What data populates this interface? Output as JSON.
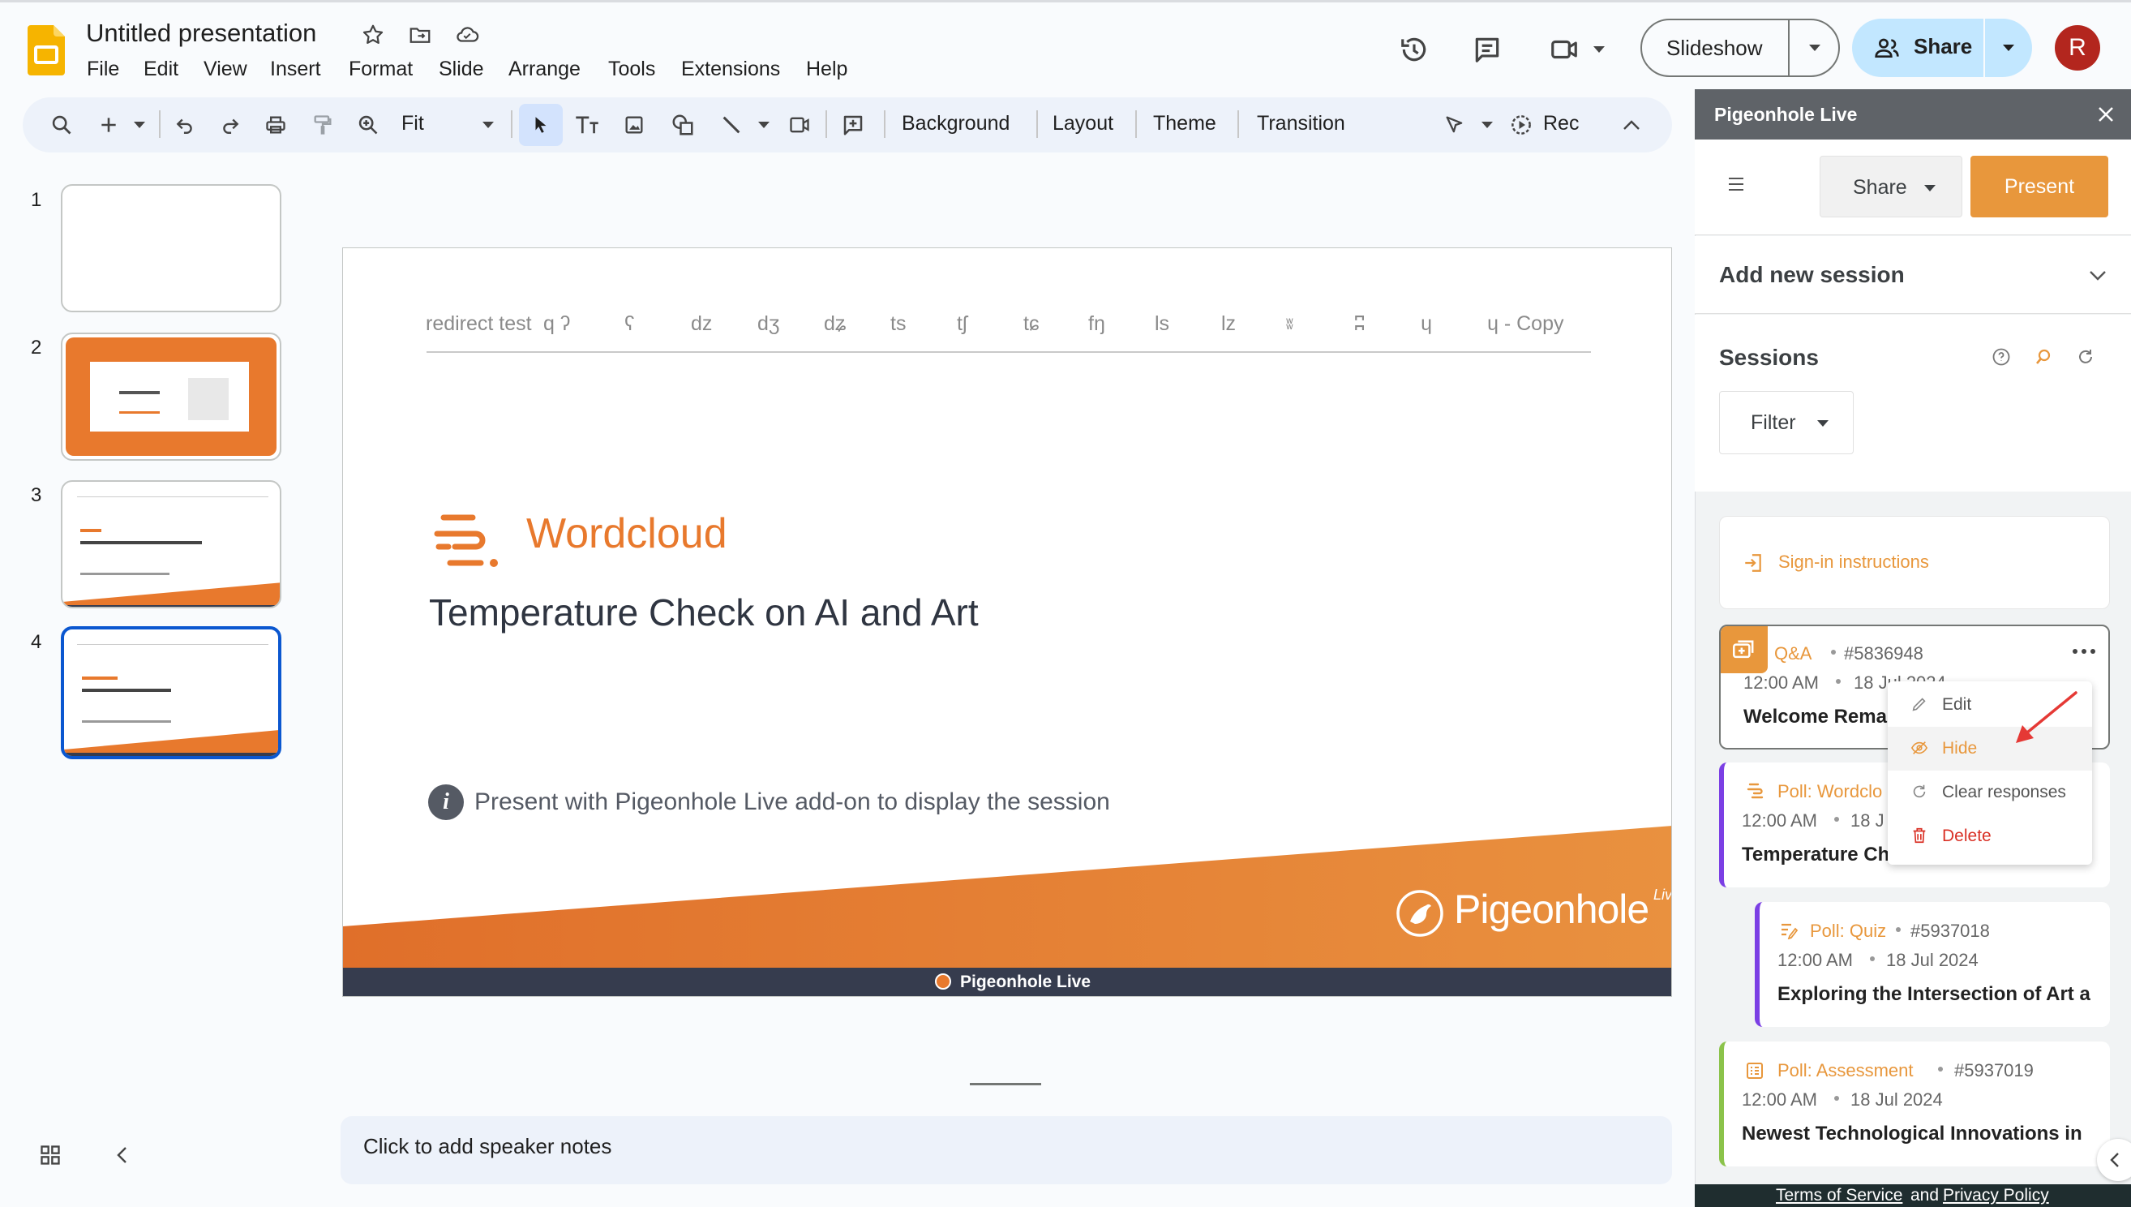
{
  "app": {
    "doc_title": "Untitled presentation",
    "menus": [
      "File",
      "Edit",
      "View",
      "Insert",
      "Format",
      "Slide",
      "Arrange",
      "Tools",
      "Extensions",
      "Help"
    ],
    "slideshow_label": "Slideshow",
    "share_label": "Share",
    "avatar_letter": "R",
    "accent": "#0b57d0",
    "share_bg": "#c2e7ff"
  },
  "toolbar": {
    "zoom_label": "Fit",
    "background_label": "Background",
    "layout_label": "Layout",
    "theme_label": "Theme",
    "transition_label": "Transition",
    "rec_label": "Rec"
  },
  "filmstrip": {
    "slides": [
      {
        "number": "1"
      },
      {
        "number": "2"
      },
      {
        "number": "3"
      },
      {
        "number": "4"
      }
    ],
    "selected": 4
  },
  "slide": {
    "tabs": [
      "redirect test",
      "q ʔ",
      "ʕ",
      "dz",
      "dʒ",
      "dʑ",
      "ts",
      "tʃ",
      "tɕ",
      "fŋ",
      "ls",
      "lz",
      "ʬ",
      "ʭ",
      "ɥ",
      "ɥ - Copy"
    ],
    "session_type": "Wordcloud",
    "title": "Temperature Check on AI and Art",
    "info_text": "Present with Pigeonhole Live add-on to display the session",
    "logo_text": "Pigeonhole",
    "logo_sup": "Live",
    "footer_text": "Pigeonhole Live",
    "orange": "#e8792d",
    "footer_color": "#363c4e"
  },
  "notes": {
    "placeholder": "Click to add speaker notes"
  },
  "panel": {
    "title": "Pigeonhole Live",
    "share_label": "Share",
    "present_label": "Present",
    "add_session_label": "Add new session",
    "sessions_label": "Sessions",
    "filter_label": "Filter",
    "signin_label": "Sign-in instructions",
    "sessions": [
      {
        "type": "Q&A",
        "id": "#5836948",
        "time": "12:00 AM",
        "date": "18 Jul 2024",
        "title": "Welcome Rema"
      },
      {
        "type": "Poll: Wordclo",
        "time": "12:00 AM",
        "date": "18 J",
        "title": "Temperature Ch"
      },
      {
        "type": "Poll: Quiz",
        "id": "#5937018",
        "time": "12:00 AM",
        "date": "18 Jul 2024",
        "title": "Exploring the Intersection of Art a"
      },
      {
        "type": "Poll: Assessment",
        "id": "#5937019",
        "time": "12:00 AM",
        "date": "18 Jul 2024",
        "title": "Newest Technological Innovations in"
      }
    ],
    "context_menu": [
      "Edit",
      "Hide",
      "Clear responses",
      "Delete"
    ],
    "footer": {
      "tos": "Terms of Service",
      "and": "and",
      "privacy": "Privacy Policy"
    },
    "present_color": "#e8973c",
    "delete_color": "#d93025",
    "poll_color": "#7b3fe4",
    "assessment_color": "#8bc34a"
  }
}
